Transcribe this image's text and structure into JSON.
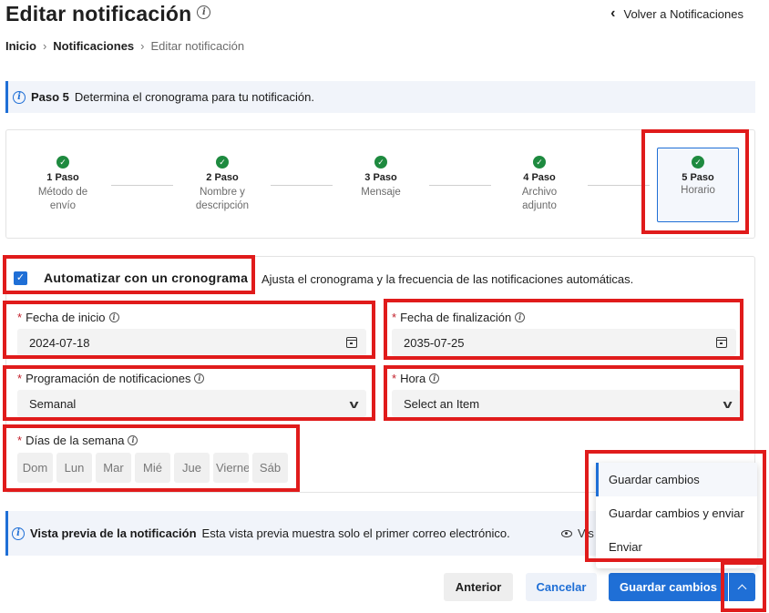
{
  "page": {
    "title": "Editar notificación",
    "back_label": "Volver a Notificaciones",
    "breadcrumb": [
      "Inicio",
      "Notificaciones",
      "Editar notificación"
    ]
  },
  "banner": {
    "step_label": "Paso 5",
    "text": "Determina el cronograma para tu notificación."
  },
  "steps": [
    {
      "num": "1 Paso",
      "label": "Método de envío"
    },
    {
      "num": "2 Paso",
      "label": "Nombre y descripción"
    },
    {
      "num": "3 Paso",
      "label": "Mensaje"
    },
    {
      "num": "4 Paso",
      "label": "Archivo adjunto"
    },
    {
      "num": "5 Paso",
      "label": "Horario"
    }
  ],
  "schedule": {
    "auto_label": "Automatizar con un cronograma",
    "auto_checked": true,
    "auto_desc": "Ajusta el cronograma y la frecuencia de las notificaciones automáticas.",
    "start_label": "Fecha de inicio",
    "start_value": "2024-07-18",
    "end_label": "Fecha de finalización",
    "end_value": "2035-07-25",
    "freq_label": "Programación de notificaciones",
    "freq_value": "Semanal",
    "time_label": "Hora",
    "time_value": "Select an Item",
    "days_label": "Días de la semana",
    "days": [
      "Dom",
      "Lun",
      "Mar",
      "Mié",
      "Jue",
      "Vierne",
      "Sáb"
    ]
  },
  "preview": {
    "title": "Vista previa de la notificación",
    "text": "Esta vista previa muestra solo el primer correo electrónico.",
    "eye_label": "Vis"
  },
  "menu": {
    "items": [
      "Guardar cambios",
      "Guardar cambios y enviar",
      "Enviar"
    ]
  },
  "footer": {
    "prev": "Anterior",
    "cancel": "Cancelar",
    "save": "Guardar cambios"
  },
  "colors": {
    "accent": "#1f6fd6",
    "success": "#1e8a3f",
    "required": "#c3202b",
    "highlight": "#e01b1b"
  }
}
